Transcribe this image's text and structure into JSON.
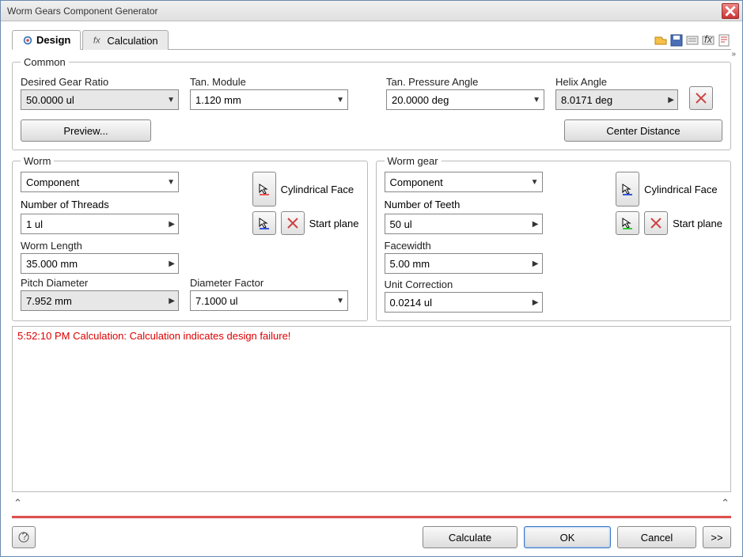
{
  "window": {
    "title": "Worm Gears Component Generator"
  },
  "tabs": {
    "design": "Design",
    "calculation": "Calculation"
  },
  "common": {
    "legend": "Common",
    "desired_gear_ratio_label": "Desired Gear Ratio",
    "desired_gear_ratio_value": "50.0000 ul",
    "tan_module_label": "Tan. Module",
    "tan_module_value": "1.120 mm",
    "tan_pressure_angle_label": "Tan. Pressure Angle",
    "tan_pressure_angle_value": "20.0000 deg",
    "helix_angle_label": "Helix Angle",
    "helix_angle_value": "8.0171 deg",
    "preview_label": "Preview...",
    "center_distance_label": "Center Distance"
  },
  "worm": {
    "legend": "Worm",
    "type_value": "Component",
    "cyl_face_label": "Cylindrical Face",
    "start_plane_label": "Start plane",
    "num_threads_label": "Number of Threads",
    "num_threads_value": "1 ul",
    "worm_length_label": "Worm Length",
    "worm_length_value": "35.000 mm",
    "pitch_diameter_label": "Pitch Diameter",
    "pitch_diameter_value": "7.952 mm",
    "diameter_factor_label": "Diameter Factor",
    "diameter_factor_value": "7.1000 ul"
  },
  "wormgear": {
    "legend": "Worm gear",
    "type_value": "Component",
    "cyl_face_label": "Cylindrical Face",
    "start_plane_label": "Start plane",
    "num_teeth_label": "Number of Teeth",
    "num_teeth_value": "50 ul",
    "facewidth_label": "Facewidth",
    "facewidth_value": "5.00 mm",
    "unit_correction_label": "Unit Correction",
    "unit_correction_value": "0.0214 ul"
  },
  "log": {
    "message": "5:52:10 PM Calculation: Calculation indicates design failure!"
  },
  "footer": {
    "calculate": "Calculate",
    "ok": "OK",
    "cancel": "Cancel",
    "expand": ">>"
  }
}
